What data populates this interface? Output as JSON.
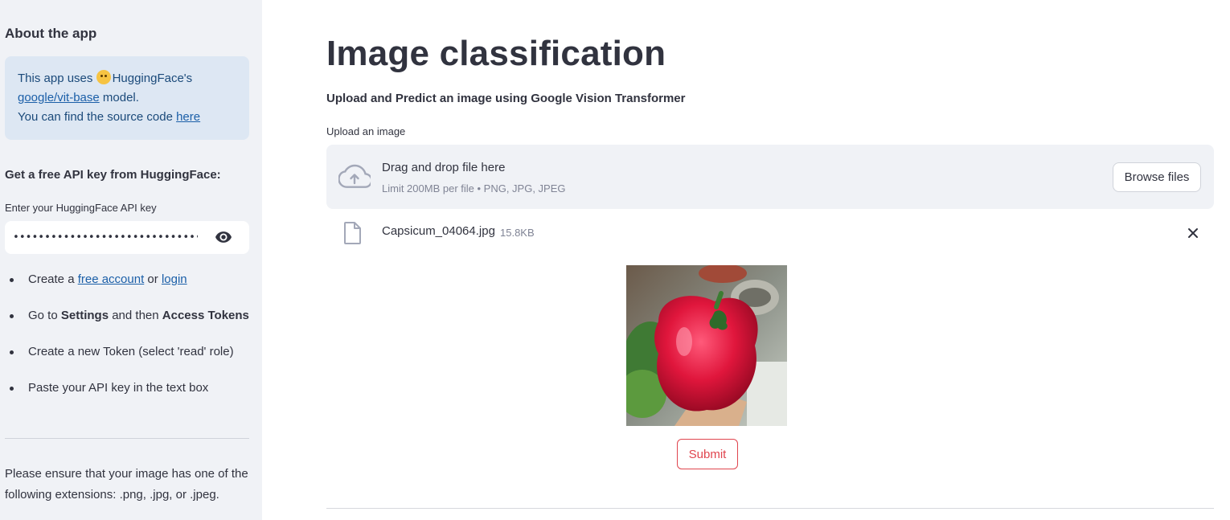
{
  "sidebar": {
    "about_title": "About the app",
    "info": {
      "line1_prefix": "This app uses ",
      "line1_suffix": "HuggingFace's",
      "model_link": "google/vit-base",
      "model_suffix": " model.",
      "source_prefix": "You can find the source code ",
      "source_link": "here"
    },
    "api_title": "Get a free API key from HuggingFace:",
    "api_label": "Enter your HuggingFace API key",
    "api_value": "•••••••••••••••••••••••••••••••••••••",
    "steps": {
      "step1_prefix": "Create a ",
      "step1_link1": "free account",
      "step1_mid": " or ",
      "step1_link2": "login",
      "step2_prefix": "Go to ",
      "step2_bold1": "Settings",
      "step2_mid": " and then ",
      "step2_bold2": "Access Tokens",
      "step3": "Create a new Token (select 'read' role)",
      "step4": "Paste your API key in the text box"
    },
    "extension_note": "Please ensure that your image has one of the following extensions: .png, .jpg, or .jpeg."
  },
  "main": {
    "title": "Image classification",
    "subtitle": "Upload and Predict an image using Google Vision Transformer",
    "upload_label": "Upload an image",
    "dropzone_text": "Drag and drop file here",
    "dropzone_limit": "Limit 200MB per file • PNG, JPG, JPEG",
    "browse_label": "Browse files",
    "file_name": "Capsicum_04064.jpg",
    "file_size": "15.8KB",
    "submit_label": "Submit"
  },
  "colors": {
    "sidebar_bg": "#f0f2f6",
    "info_bg": "#dde7f3",
    "link": "#1b5fa8",
    "submit_accent": "#e0454e"
  },
  "icons": [
    "hugging-face-emoji-icon",
    "eye-icon",
    "cloud-upload-icon",
    "file-icon",
    "close-icon"
  ]
}
